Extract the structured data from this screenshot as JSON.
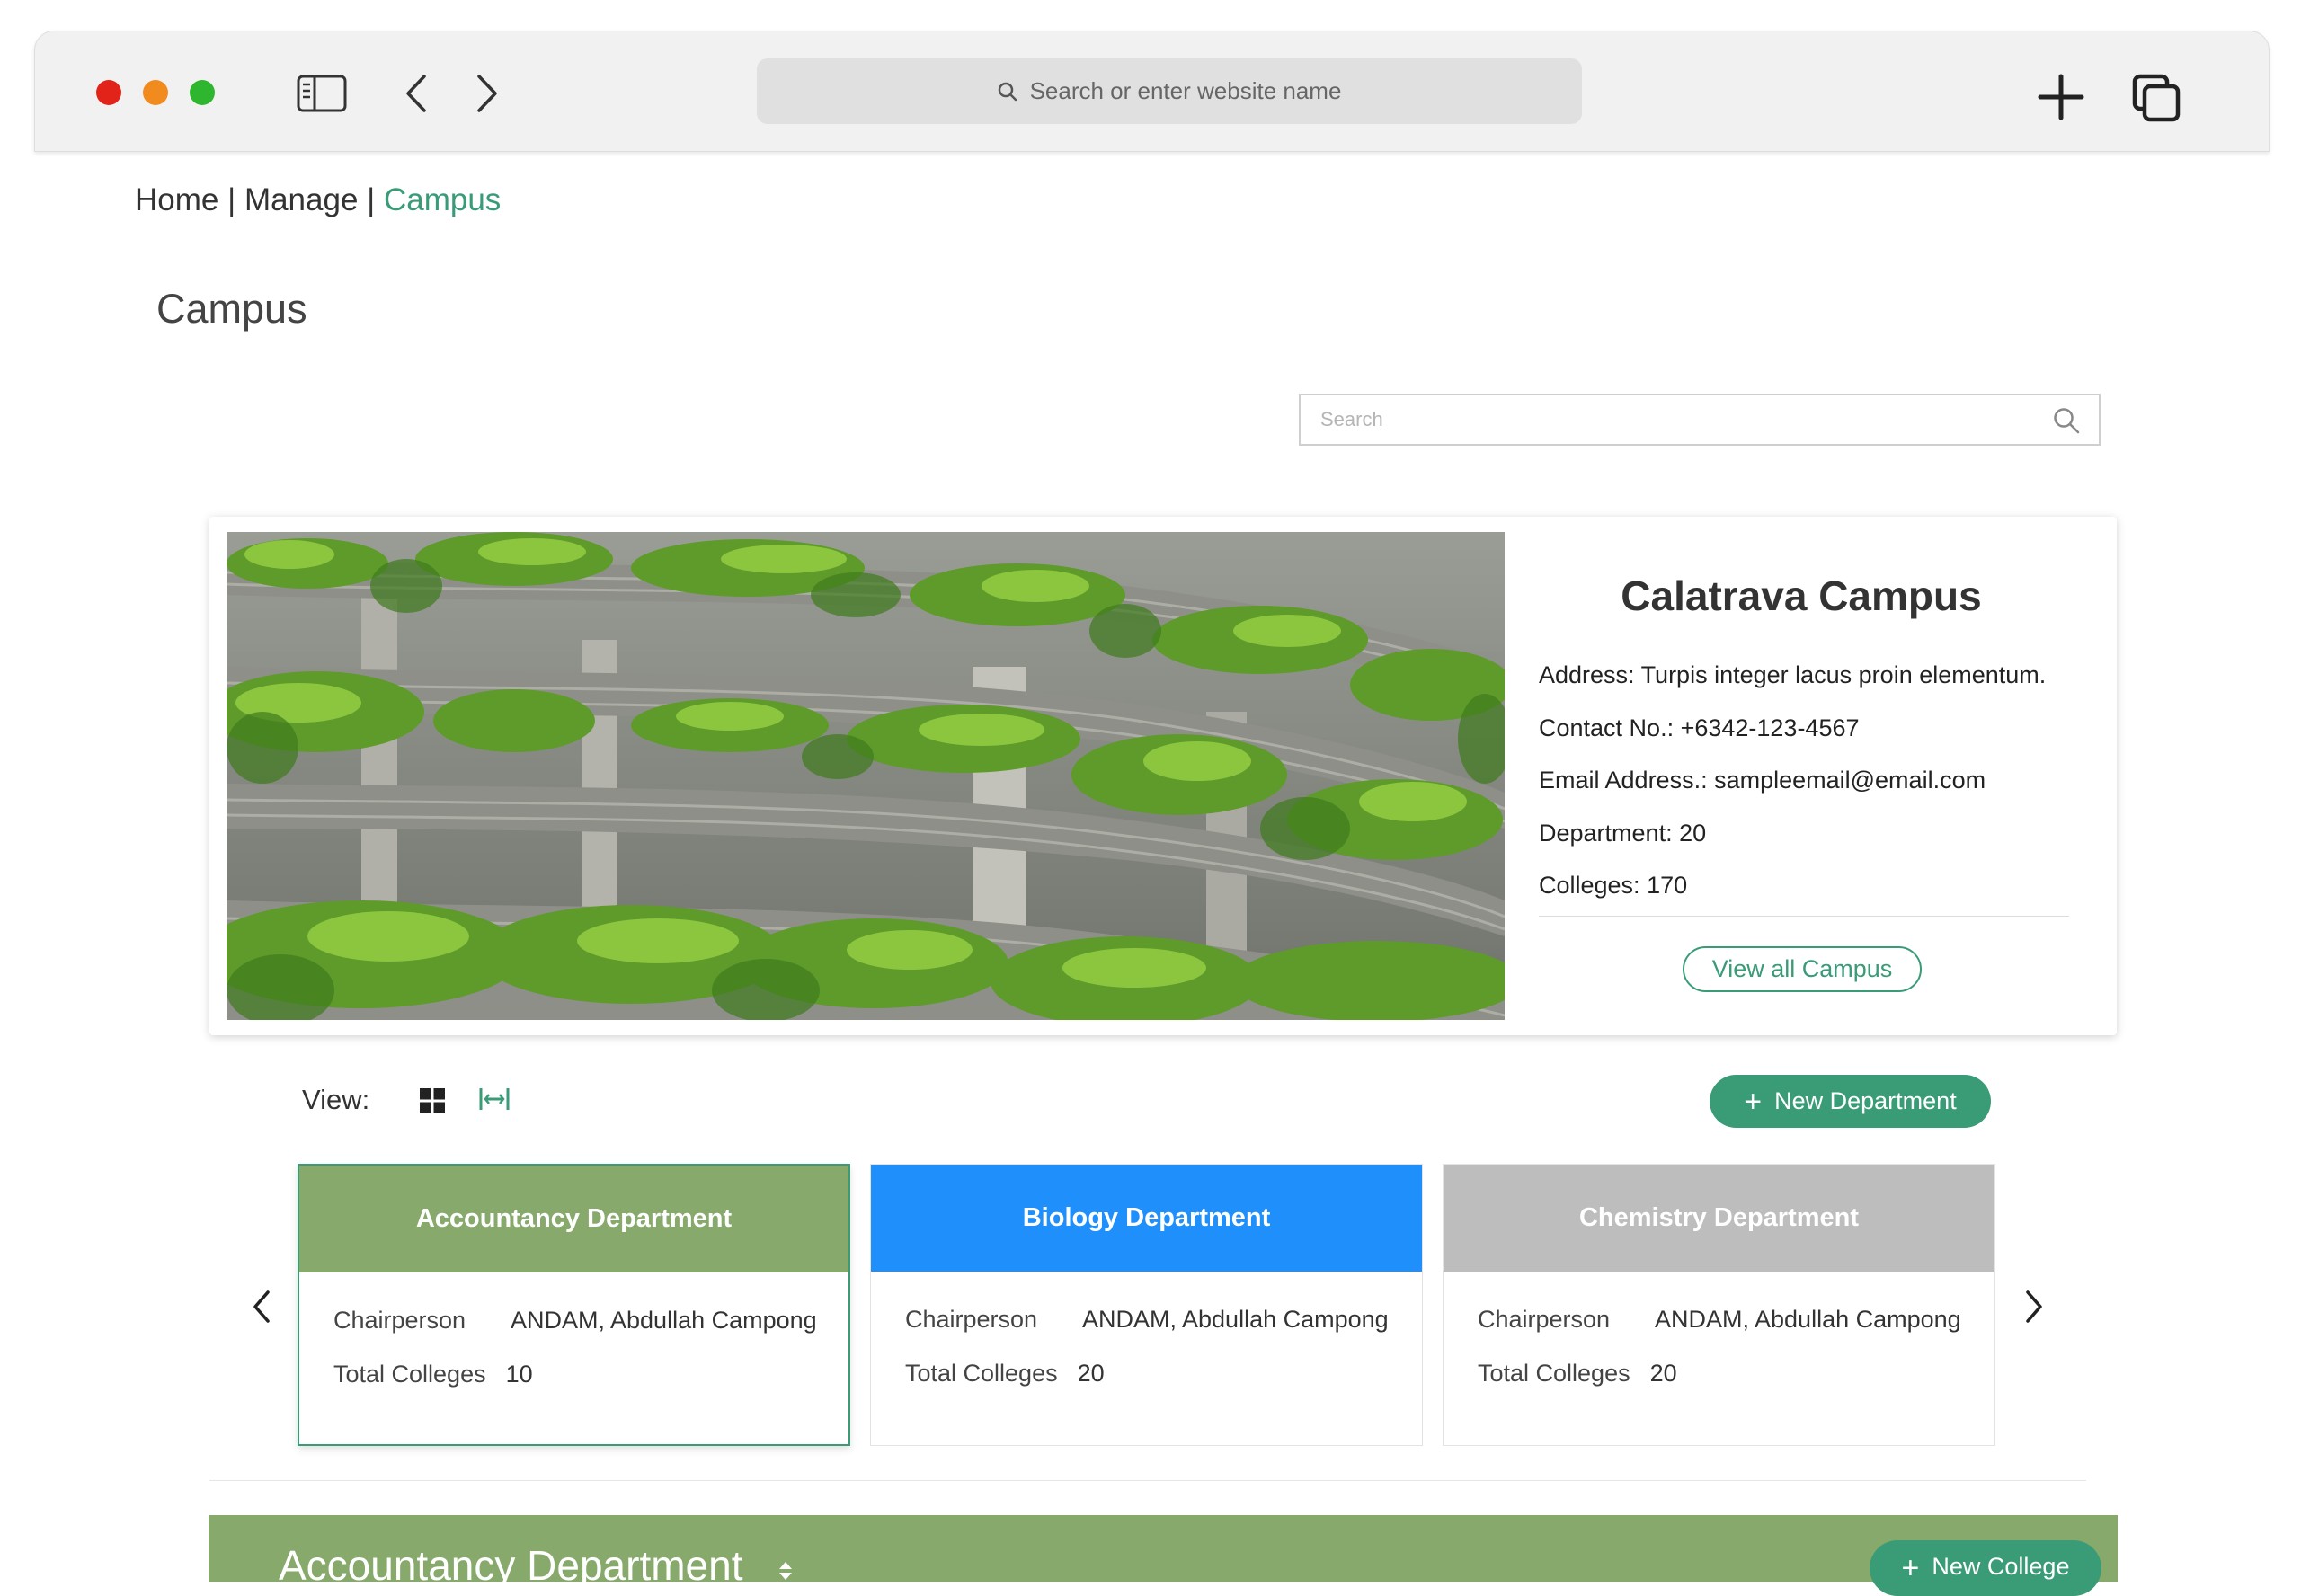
{
  "browser": {
    "url_placeholder": "Search or enter website name",
    "traffic_lights": {
      "close": "#e2231a",
      "minimize": "#f28b1e",
      "zoom": "#2fb62f"
    },
    "icons": [
      "sidebar-icon",
      "back-icon",
      "forward-icon",
      "new-tab-icon",
      "tabs-icon"
    ]
  },
  "breadcrumb": {
    "home": "Home",
    "separator": "|",
    "manage": "Manage",
    "current": "Campus"
  },
  "page": {
    "title": "Campus"
  },
  "search": {
    "placeholder": "Search",
    "icon": "search-icon"
  },
  "campus": {
    "name": "Calatrava Campus",
    "address": "Address: Turpis integer lacus proin elementum.",
    "contact": "Contact No.: +6342-123-4567",
    "email": "Email Address.: sampleemail@email.com",
    "departments": "Department: 20",
    "colleges": "Colleges: 170",
    "view_all_label": "View all Campus"
  },
  "view": {
    "label": "View:",
    "options": [
      "grid-icon",
      "list-icon"
    ],
    "new_department_label": "New Department"
  },
  "departments": [
    {
      "name": "Accountancy Department",
      "color": "#87a96b",
      "chairperson_label": "Chairperson",
      "chairperson": "ANDAM, Abdullah Campong",
      "total_label": "Total Colleges",
      "total": "10"
    },
    {
      "name": "Biology Department",
      "color": "#1e8ffb",
      "chairperson_label": "Chairperson",
      "chairperson": "ANDAM, Abdullah Campong",
      "total_label": "Total Colleges",
      "total": "20"
    },
    {
      "name": "Chemistry Department",
      "color": "#bdbdbd",
      "chairperson_label": "Chairperson",
      "chairperson": "ANDAM, Abdullah Campong",
      "total_label": "Total Colleges",
      "total": "20"
    }
  ],
  "selected_department": {
    "title": "Accountancy Department",
    "new_college_label": "New College"
  },
  "colors": {
    "accent": "#3a9b77",
    "section_bar": "#87a96b"
  }
}
